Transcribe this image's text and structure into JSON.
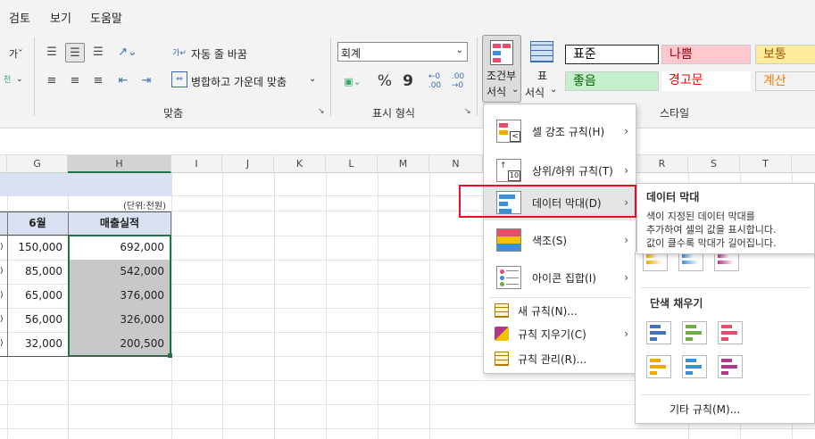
{
  "menubar": {
    "tabs": [
      "검토",
      "보기",
      "도움말"
    ]
  },
  "ribbon": {
    "alignment": {
      "wrap_text": "자동 줄 바꿈",
      "merge_center": "병합하고 가운데 맞춤",
      "group_label": "맞춤"
    },
    "number": {
      "format_value": "회계",
      "currency_symbol": "%",
      "comma_symbol": "9",
      "group_label": "표시 형식"
    },
    "styles": {
      "conditional_formatting": "조건부\n서식",
      "cf_line1": "조건부",
      "cf_line2": "서식",
      "format_table_line1": "표",
      "format_table_line2": "서식",
      "group_label": "스타일",
      "cells": [
        {
          "label": "표준",
          "bg": "#ffffff",
          "color": "#000000"
        },
        {
          "label": "나쁨",
          "bg": "#ffc7ce",
          "color": "#9c0006"
        },
        {
          "label": "보통",
          "bg": "#ffeb9c",
          "color": "#9c5700"
        },
        {
          "label": "좋음",
          "bg": "#c6efce",
          "color": "#006100"
        },
        {
          "label": "경고문",
          "bg": "#ffffff",
          "color": "#ff0000"
        },
        {
          "label": "계산",
          "bg": "#f2f2f2",
          "color": "#fa7d00"
        }
      ]
    }
  },
  "sheet": {
    "columns": [
      "G",
      "H",
      "I",
      "J",
      "K",
      "L",
      "M",
      "N",
      "R",
      "S",
      "T"
    ],
    "unit_note": "(단위:천원)",
    "headers": {
      "g": "6월",
      "h": "매출실적"
    },
    "rows": [
      {
        "g": "150,000",
        "h": "692,000"
      },
      {
        "g": "85,000",
        "h": "542,000"
      },
      {
        "g": "65,000",
        "h": "376,000"
      },
      {
        "g": "56,000",
        "h": "326,000"
      },
      {
        "g": "32,000",
        "h": "200,500"
      }
    ]
  },
  "cf_menu": {
    "items": [
      {
        "label": "셀 강조 규칙(H)"
      },
      {
        "label": "상위/하위 규칙(T)"
      },
      {
        "label": "데이터 막대(D)"
      },
      {
        "label": "색조(S)"
      },
      {
        "label": "아이콘 집합(I)"
      },
      {
        "label": "새 규칙(N)..."
      },
      {
        "label": "규칙 지우기(C)"
      },
      {
        "label": "규칙 관리(R)..."
      }
    ],
    "highlight_color": "#e81123"
  },
  "tooltip": {
    "title": "데이터 막대",
    "line1": "색이 지정된 데이터 막대를",
    "line2": "추가하여 셀의 값을 표시합니다.",
    "line3": "값이 클수록 막대가 길어집니다."
  },
  "submenu": {
    "solid_fill_label": "단색 채우기",
    "more_rules": "기타 규칙(M)...",
    "colors": [
      "#4472c4",
      "#70ad47",
      "#e84d6b",
      "#f2a900",
      "#3a8fd9",
      "#b03a8a"
    ]
  }
}
